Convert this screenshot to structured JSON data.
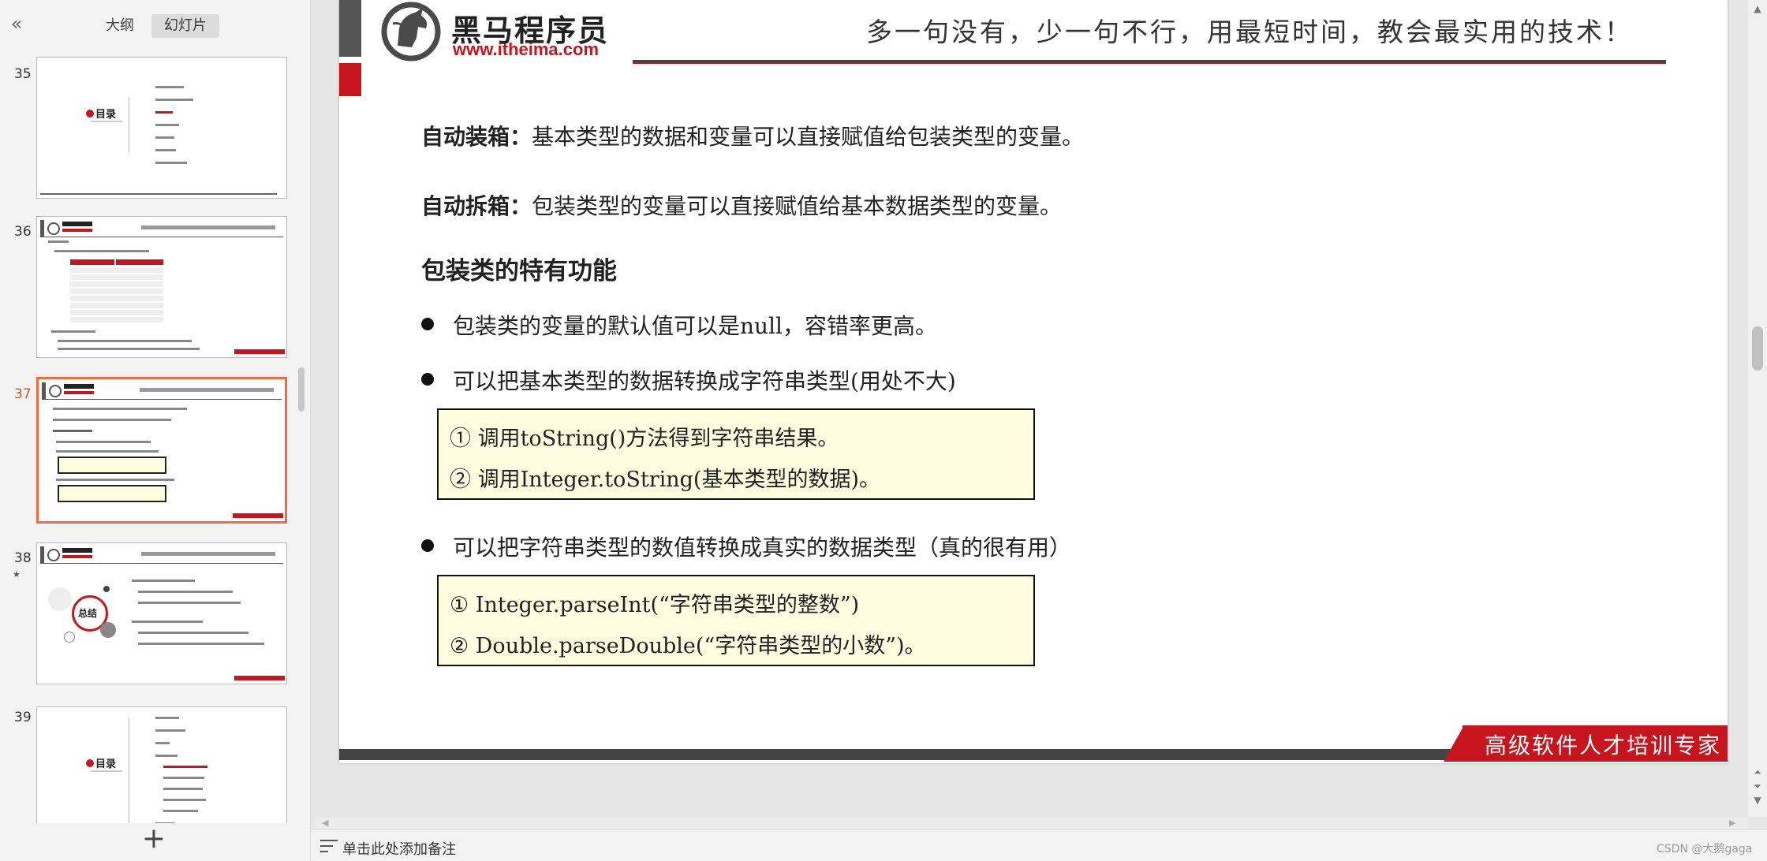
{
  "left_panel": {
    "tabs": [
      "大纲",
      "幻灯片"
    ],
    "active_tab": "幻灯片",
    "thumbnails": [
      {
        "number": "35",
        "kind": "toc",
        "toc_label": "目录"
      },
      {
        "number": "36",
        "kind": "table"
      },
      {
        "number": "37",
        "kind": "content",
        "active": true
      },
      {
        "number": "38",
        "kind": "summary",
        "summary_label": "总结"
      },
      {
        "number": "39",
        "kind": "toc",
        "toc_label": "目录"
      }
    ]
  },
  "slide": {
    "brand": "黑马程序员",
    "url": "www.itheima.com",
    "slogan": "多一句没有，少一句不行，用最短时间，教会最实用的技术！",
    "para1_label": "自动装箱：",
    "para1_text": "基本类型的数据和变量可以直接赋值给包装类型的变量。",
    "para2_label": "自动拆箱：",
    "para2_text": "包装类型的变量可以直接赋值给基本数据类型的变量。",
    "heading": "包装类的特有功能",
    "bullet1": "包装类的变量的默认值可以是null，容错率更高。",
    "bullet2": "可以把基本类型的数据转换成字符串类型(用处不大)",
    "box1_line1": "①  调用toString()方法得到字符串结果。",
    "box1_line2": "②  调用Integer.toString(基本类型的数据)。",
    "bullet3": "可以把字符串类型的数值转换成真实的数据类型（真的很有用）",
    "box2_line1": "①  Integer.parseInt(“字符串类型的整数”)",
    "box2_line2": "②  Double.parseDouble(“字符串类型的小数”)。",
    "footer_tag": "高级软件人才培训专家"
  },
  "notes_bar": {
    "placeholder": "单击此处添加备注"
  },
  "watermark": "CSDN @大鹅gaga",
  "colors": {
    "brand_red": "#c8151d",
    "active_thumb": "#f26a3d",
    "box_fill": "#fffde0"
  }
}
